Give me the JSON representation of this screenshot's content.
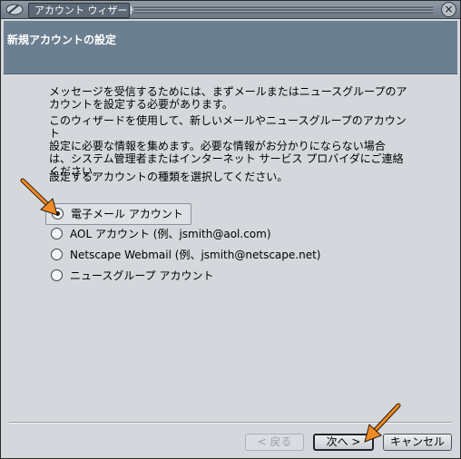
{
  "window": {
    "title": "アカウント ウィザード",
    "close_glyph": "×"
  },
  "header": {
    "title": "新規アカウントの設定"
  },
  "body": {
    "intro": "メッセージを受信するためには、まずメールまたはニュースグループのア\nカウントを設定する必要があります。",
    "wizard_info": "このウィザードを使用して、新しいメールやニュースグループのアカウント\n設定に必要な情報を集めます。必要な情報がお分かりにならない場合\nは、システム管理者またはインターネット サービス プロバイダにご連絡\nください。",
    "select_prompt": "設定するアカウントの種類を選択してください。"
  },
  "account_types": [
    {
      "label": "電子メール アカウント",
      "selected": true
    },
    {
      "label": "AOL アカウント (例、jsmith@aol.com)",
      "selected": false
    },
    {
      "label": "Netscape Webmail (例、jsmith@netscape.net)",
      "selected": false
    },
    {
      "label": "ニュースグループ アカウント",
      "selected": false
    }
  ],
  "buttons": {
    "back": "< 戻る",
    "next": "次へ >",
    "cancel": "キャンセル"
  },
  "colors": {
    "header_bg": "#6b7f91",
    "dialog_bg": "#d4d8dc",
    "annotation_arrow": "#f08a24"
  }
}
